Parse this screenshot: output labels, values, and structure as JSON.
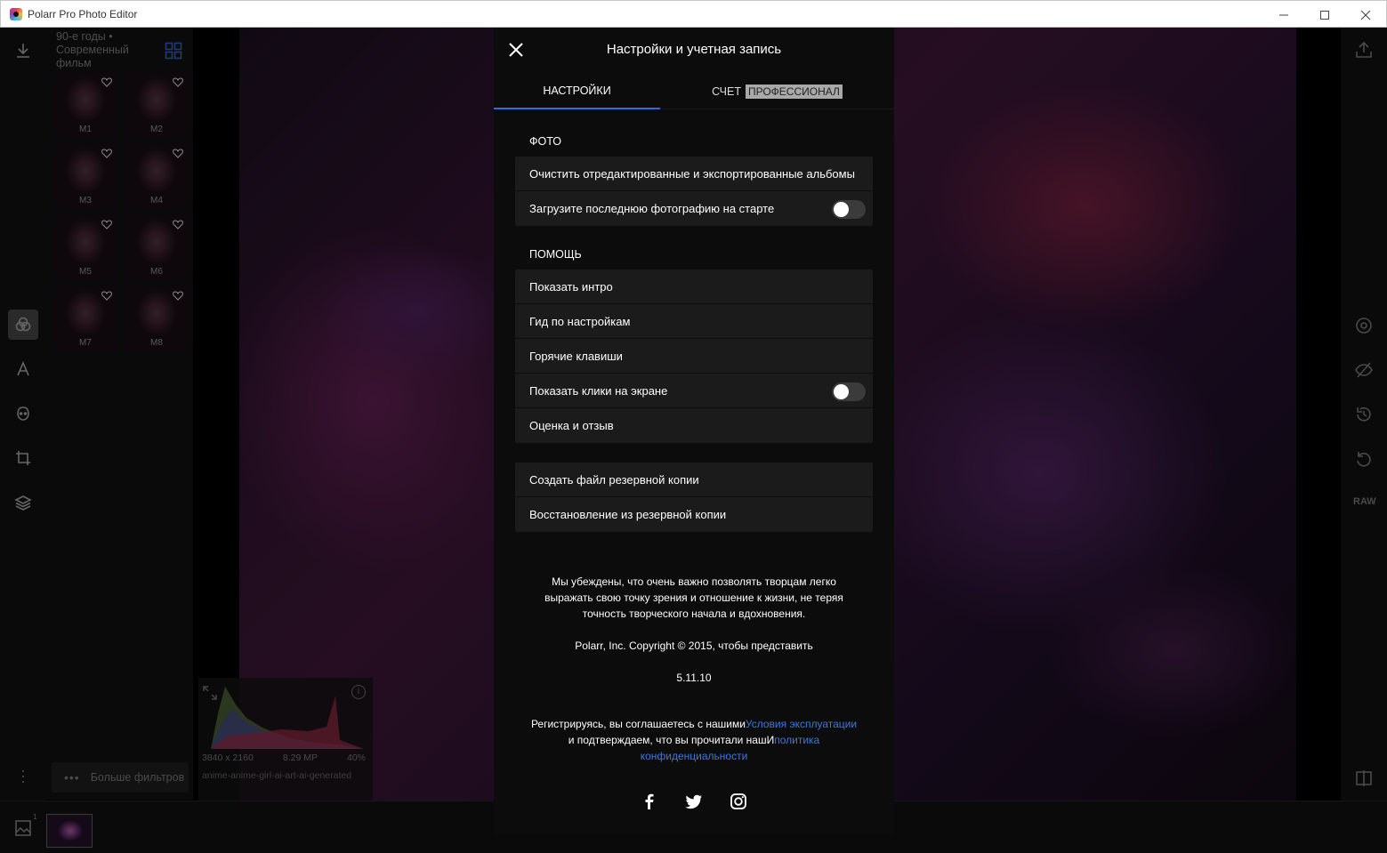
{
  "window": {
    "title": "Polarr Pro Photo Editor",
    "controls": {
      "minimize": "—",
      "maximize": "☐",
      "close": "✕"
    }
  },
  "filters_panel": {
    "category": "90-е годы • Современный фильм",
    "thumbnails": [
      "M1",
      "M2",
      "M3",
      "M4",
      "M5",
      "M6",
      "M7",
      "M8"
    ],
    "more_filters_label": "Больше фильтров",
    "more_dots": "•••"
  },
  "histogram": {
    "resolution": "3840 x 2160",
    "megapixels": "8.29 MP",
    "zoom": "40%",
    "filename": "anime-anime-girl-ai-art-ai-generated",
    "info": "i"
  },
  "right_toolbar": {
    "raw_label": "RAW"
  },
  "bottom": {
    "gallery_count": "1"
  },
  "settings": {
    "title": "Настройки и учетная запись",
    "tabs": {
      "settings": "НАСТРОЙКИ",
      "account": "СЧЕТ",
      "account_badge": "ПРОФЕССИОНАЛ"
    },
    "photo_section": {
      "title": "ФОТО",
      "items": [
        {
          "label": "Очистить отредактированные и экспортированные альбомы"
        },
        {
          "label": "Загрузите последнюю фотографию на старте",
          "toggle": false
        }
      ]
    },
    "help_section": {
      "title": "ПОМОЩЬ",
      "items": [
        {
          "label": "Показать интро"
        },
        {
          "label": "Гид по настройкам"
        },
        {
          "label": "Горячие клавиши"
        },
        {
          "label": "Показать клики на экране",
          "toggle": false
        },
        {
          "label": "Оценка и отзыв"
        }
      ]
    },
    "backup_section": {
      "items": [
        {
          "label": "Создать файл резервной копии"
        },
        {
          "label": "Восстановление из резервной копии"
        }
      ]
    },
    "about": {
      "mission_line1": "Мы убеждены, что очень важно позволять творцам легко",
      "mission_line2": "выражать свою точку зрения и отношение к жизни, не теряя",
      "mission_line3": "точность творческого начала и вдохновения.",
      "copyright": "Polarr, Inc. Copyright © 2015, чтобы представить",
      "version": "5.11.10",
      "terms_prefix": "Регистрируясь, вы соглашаетесь с нашими",
      "terms_link": "Условия эксплуатации",
      "terms_middle": " и подтверждаем, что вы прочитали нашИ",
      "privacy_link": "политика конфиденциальности"
    },
    "socials": [
      "facebook-icon",
      "twitter-icon",
      "instagram-icon"
    ]
  },
  "colors": {
    "accent": "#2d6fd8",
    "link": "#3f76e0",
    "modal_bg": "#0c0c0c",
    "row_bg": "#1b1b1b"
  }
}
